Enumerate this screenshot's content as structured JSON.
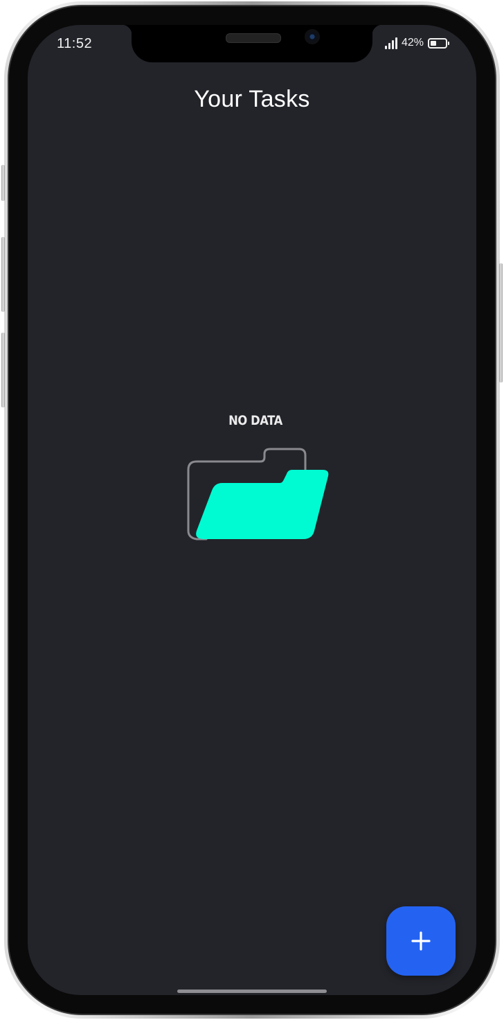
{
  "status_bar": {
    "time": "11:52",
    "battery_percent_label": "42%",
    "battery_level": 0.42,
    "signal_bars": 4
  },
  "header": {
    "title": "Your Tasks"
  },
  "empty_state": {
    "label": "NO DATA",
    "icon": "folder-icon",
    "icon_color": "#00fbd2",
    "outline_color": "#8a8a8e"
  },
  "fab": {
    "icon": "plus-icon",
    "color": "#2463f2"
  },
  "colors": {
    "background": "#23242a",
    "title_text": "#ffffff"
  }
}
